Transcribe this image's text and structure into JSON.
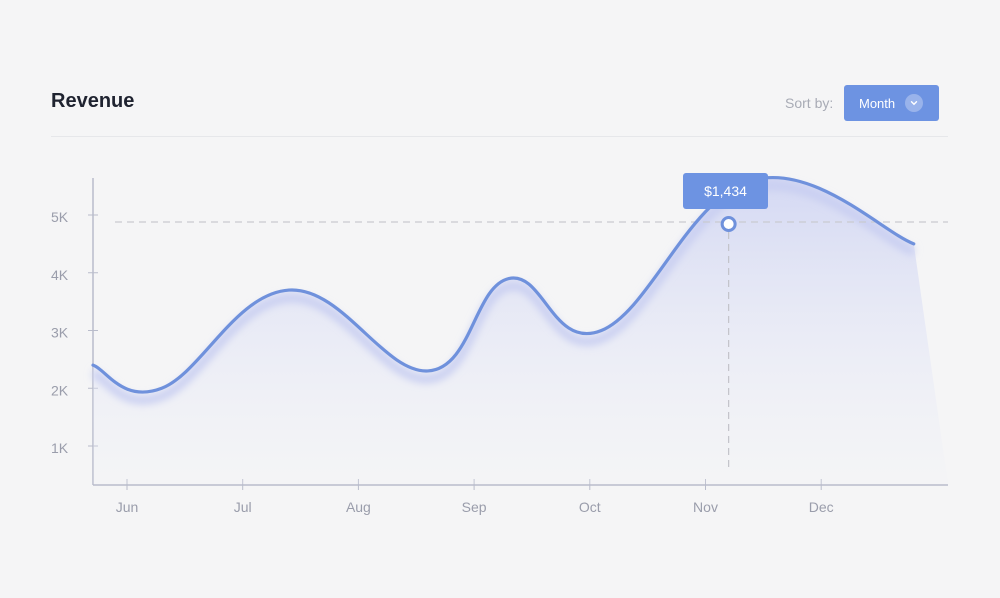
{
  "header": {
    "title": "Revenue",
    "sort_label": "Sort by:",
    "sort_value": "Month",
    "sort_icon": "chevron-down-icon"
  },
  "colors": {
    "accent": "#6d93e2",
    "line": "#6f91dc",
    "axis": "#b9bccb",
    "background": "#f5f5f6"
  },
  "tooltip": {
    "value": "$1,434",
    "month": "Nov"
  },
  "chart_data": {
    "type": "area",
    "title": "Revenue",
    "xlabel": "",
    "ylabel": "",
    "categories": [
      "Jun",
      "Jul",
      "Aug",
      "Sep",
      "Oct",
      "Nov",
      "Dec"
    ],
    "y_ticks": [
      "1K",
      "2K",
      "3K",
      "4K",
      "5K"
    ],
    "ylim": [
      0.3,
      5.6
    ],
    "grid": false,
    "series": [
      {
        "name": "Revenue",
        "x": [
          -0.3,
          0.3,
          1.4,
          2.6,
          3.3,
          4.1,
          5.4,
          6.8
        ],
        "values": [
          2.4,
          2.0,
          3.7,
          2.3,
          3.9,
          3.0,
          5.6,
          4.5
        ]
      }
    ],
    "highlight": {
      "x": 5.2,
      "label": "$1,434",
      "reference_value": 5.0
    }
  }
}
